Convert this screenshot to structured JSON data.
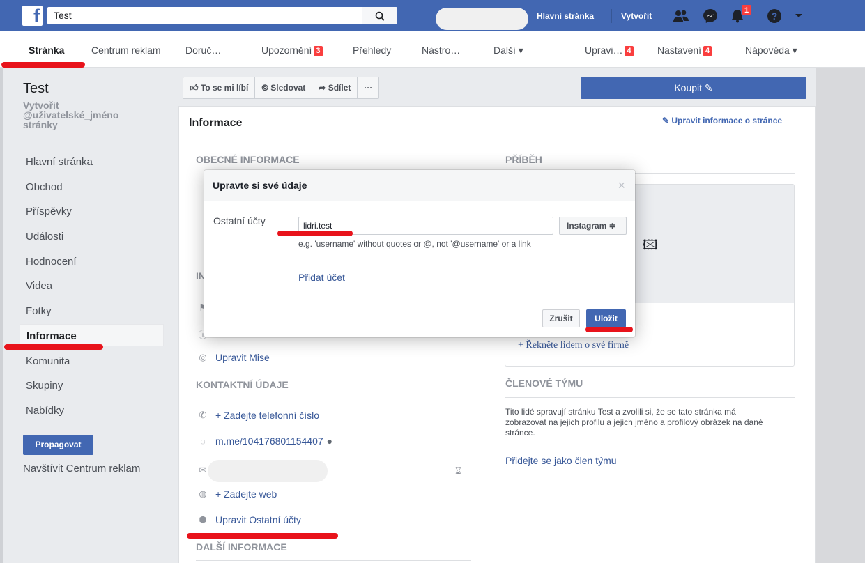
{
  "topbar": {
    "search_value": "Test",
    "home_link": "Hlavní stránka",
    "create_link": "Vytvořit",
    "notifications_count": "1"
  },
  "pagenav": {
    "items": [
      {
        "label": "Stránka"
      },
      {
        "label": "Centrum reklam"
      },
      {
        "label": "Doruč…"
      },
      {
        "label": "Upozornění",
        "badge": "3"
      },
      {
        "label": "Přehledy"
      },
      {
        "label": "Nástro…"
      },
      {
        "label": "Další ▾"
      },
      {
        "label": "Upravi…",
        "badge": "4"
      },
      {
        "label": "Nastavení",
        "badge": "4"
      },
      {
        "label": "Nápověda ▾"
      }
    ]
  },
  "sidebar": {
    "page_name": "Test",
    "create_username": "Vytvořit @uživatelské_jméno stránky",
    "items": [
      {
        "label": "Hlavní stránka"
      },
      {
        "label": "Obchod"
      },
      {
        "label": "Příspěvky"
      },
      {
        "label": "Události"
      },
      {
        "label": "Hodnocení"
      },
      {
        "label": "Videa"
      },
      {
        "label": "Fotky"
      },
      {
        "label": "Informace"
      },
      {
        "label": "Komunita"
      },
      {
        "label": "Skupiny"
      },
      {
        "label": "Nabídky"
      }
    ],
    "promote_label": "Propagovat",
    "visit_ads_label": "Navštívit Centrum reklam"
  },
  "actions": {
    "like": "To se mi líbí",
    "follow": "Sledovat",
    "share": "Sdílet",
    "more": "···",
    "buy": "Koupit"
  },
  "info": {
    "title": "Informace",
    "edit_link": "Upravit informace o stránce",
    "general_header": "OBECNÉ INFORMACE",
    "partial_header": "IN",
    "mission_link": "Upravit Mise",
    "contact_header": "KONTAKTNÍ ÚDAJE",
    "phone_link": "+ Zadejte telefonní číslo",
    "messenger_link": "m.me/104176801154407",
    "web_link": "+ Zadejte web",
    "other_accounts_link": "Upravit Ostatní účty",
    "more_header": "DALŠÍ INFORMACE",
    "story_header": "PŘÍBĚH",
    "story_link": "+ Řekněte lidem o své firmě",
    "team_header": "ČLENOVÉ TÝMU",
    "team_text": "Tito lidé spravují stránku Test a zvolili si, že se tato stránka má zobrazovat na jejich profilu a jejich jméno a profilový obrázek na dané stránce.",
    "team_link": "Přidejte se jako člen týmu"
  },
  "modal": {
    "title": "Upravte si své údaje",
    "field_label": "Ostatní účty",
    "field_value": "lidri.test",
    "platform": "Instagram ≑",
    "hint": "e.g. 'username' without quotes or @, not '@username' or a link",
    "add_account": "Přidat účet",
    "cancel": "Zrušit",
    "save": "Uložit"
  },
  "colors": {
    "brand": "#4267b2",
    "annotation_red": "#e8131b"
  }
}
